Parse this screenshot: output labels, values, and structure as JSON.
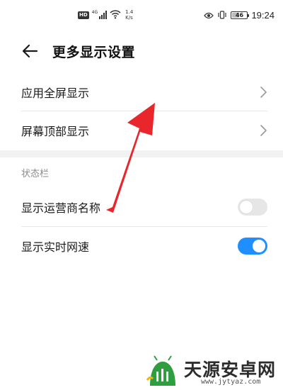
{
  "status_bar": {
    "hd_label": "HD",
    "network_label": "4G",
    "speed_value": "1.4",
    "speed_unit": "K/s",
    "battery_level": "46",
    "time": "19:24"
  },
  "header": {
    "back_icon": "arrow-left-icon",
    "title": "更多显示设置"
  },
  "settings": {
    "fullscreen_label": "应用全屏显示",
    "notch_label": "屏幕顶部显示",
    "section_title": "状态栏",
    "carrier_label": "显示运营商名称",
    "carrier_enabled": false,
    "netspeed_label": "显示实时网速",
    "netspeed_enabled": true
  },
  "watermark": {
    "brand": "天源安卓网",
    "url": "www.jytyaz.com"
  },
  "colors": {
    "accent": "#1f8fff",
    "annotation_arrow": "#e8262b",
    "toggle_off": "#e6e6e6"
  }
}
